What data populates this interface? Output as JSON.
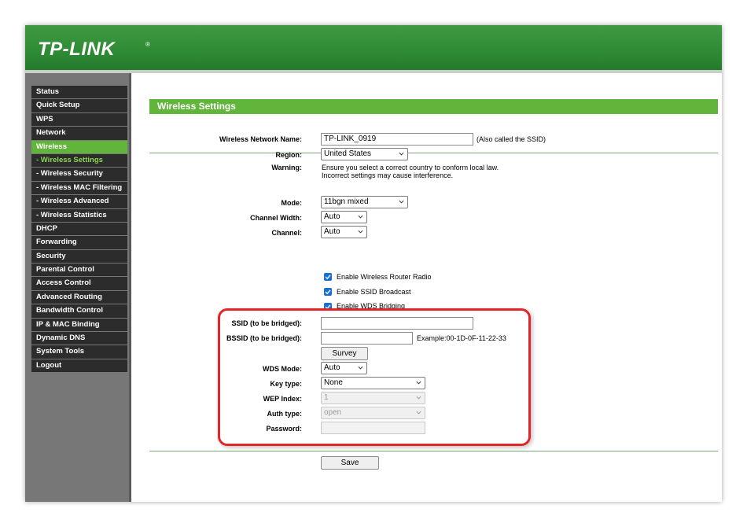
{
  "header": {
    "logo": "TP-LINK",
    "logo_mark": "®"
  },
  "sidebar": {
    "items": [
      {
        "label": "Status"
      },
      {
        "label": "Quick Setup"
      },
      {
        "label": "WPS"
      },
      {
        "label": "Network"
      },
      {
        "label": "Wireless"
      },
      {
        "label": "- Wireless Settings"
      },
      {
        "label": "- Wireless Security"
      },
      {
        "label": "- Wireless MAC Filtering"
      },
      {
        "label": "- Wireless Advanced"
      },
      {
        "label": "- Wireless Statistics"
      },
      {
        "label": "DHCP"
      },
      {
        "label": "Forwarding"
      },
      {
        "label": "Security"
      },
      {
        "label": "Parental Control"
      },
      {
        "label": "Access Control"
      },
      {
        "label": "Advanced Routing"
      },
      {
        "label": "Bandwidth Control"
      },
      {
        "label": "IP & MAC Binding"
      },
      {
        "label": "Dynamic DNS"
      },
      {
        "label": "System Tools"
      },
      {
        "label": "Logout"
      }
    ],
    "active_item": "Wireless",
    "active_subitem": "- Wireless Settings"
  },
  "page": {
    "title": "Wireless Settings"
  },
  "form": {
    "network_name": {
      "label": "Wireless Network Name:",
      "value": "TP-LINK_0919",
      "note": "(Also called the SSID)"
    },
    "region": {
      "label": "Region:",
      "value": "United States"
    },
    "warning": {
      "label": "Warning:",
      "line1": "Ensure you select a correct country to conform local law.",
      "line2": "Incorrect settings may cause interference."
    },
    "mode": {
      "label": "Mode:",
      "value": "11bgn mixed"
    },
    "channel_width": {
      "label": "Channel Width:",
      "value": "Auto"
    },
    "channel": {
      "label": "Channel:",
      "value": "Auto"
    },
    "enable_radio": {
      "label": "Enable Wireless Router Radio",
      "checked": true
    },
    "enable_ssid_broadcast": {
      "label": "Enable SSID Broadcast",
      "checked": true
    },
    "enable_wds": {
      "label": "Enable WDS Bridging",
      "checked": true
    },
    "wds": {
      "ssid": {
        "label": "SSID (to be bridged):",
        "value": ""
      },
      "bssid": {
        "label": "BSSID (to be bridged):",
        "value": "",
        "example": "Example:00-1D-0F-11-22-33"
      },
      "survey_button": "Survey",
      "wds_mode": {
        "label": "WDS Mode:",
        "value": "Auto"
      },
      "key_type": {
        "label": "Key type:",
        "value": "None"
      },
      "wep_index": {
        "label": "WEP Index:",
        "value": "1"
      },
      "auth_type": {
        "label": "Auth type:",
        "value": "open"
      },
      "password": {
        "label": "Password:",
        "value": ""
      }
    },
    "save_button": "Save"
  },
  "colors": {
    "brand_green": "#2e8b34",
    "accent_green": "#61b53a",
    "highlight_red": "#e3252a",
    "checkbox_blue": "#1a6fd6"
  }
}
